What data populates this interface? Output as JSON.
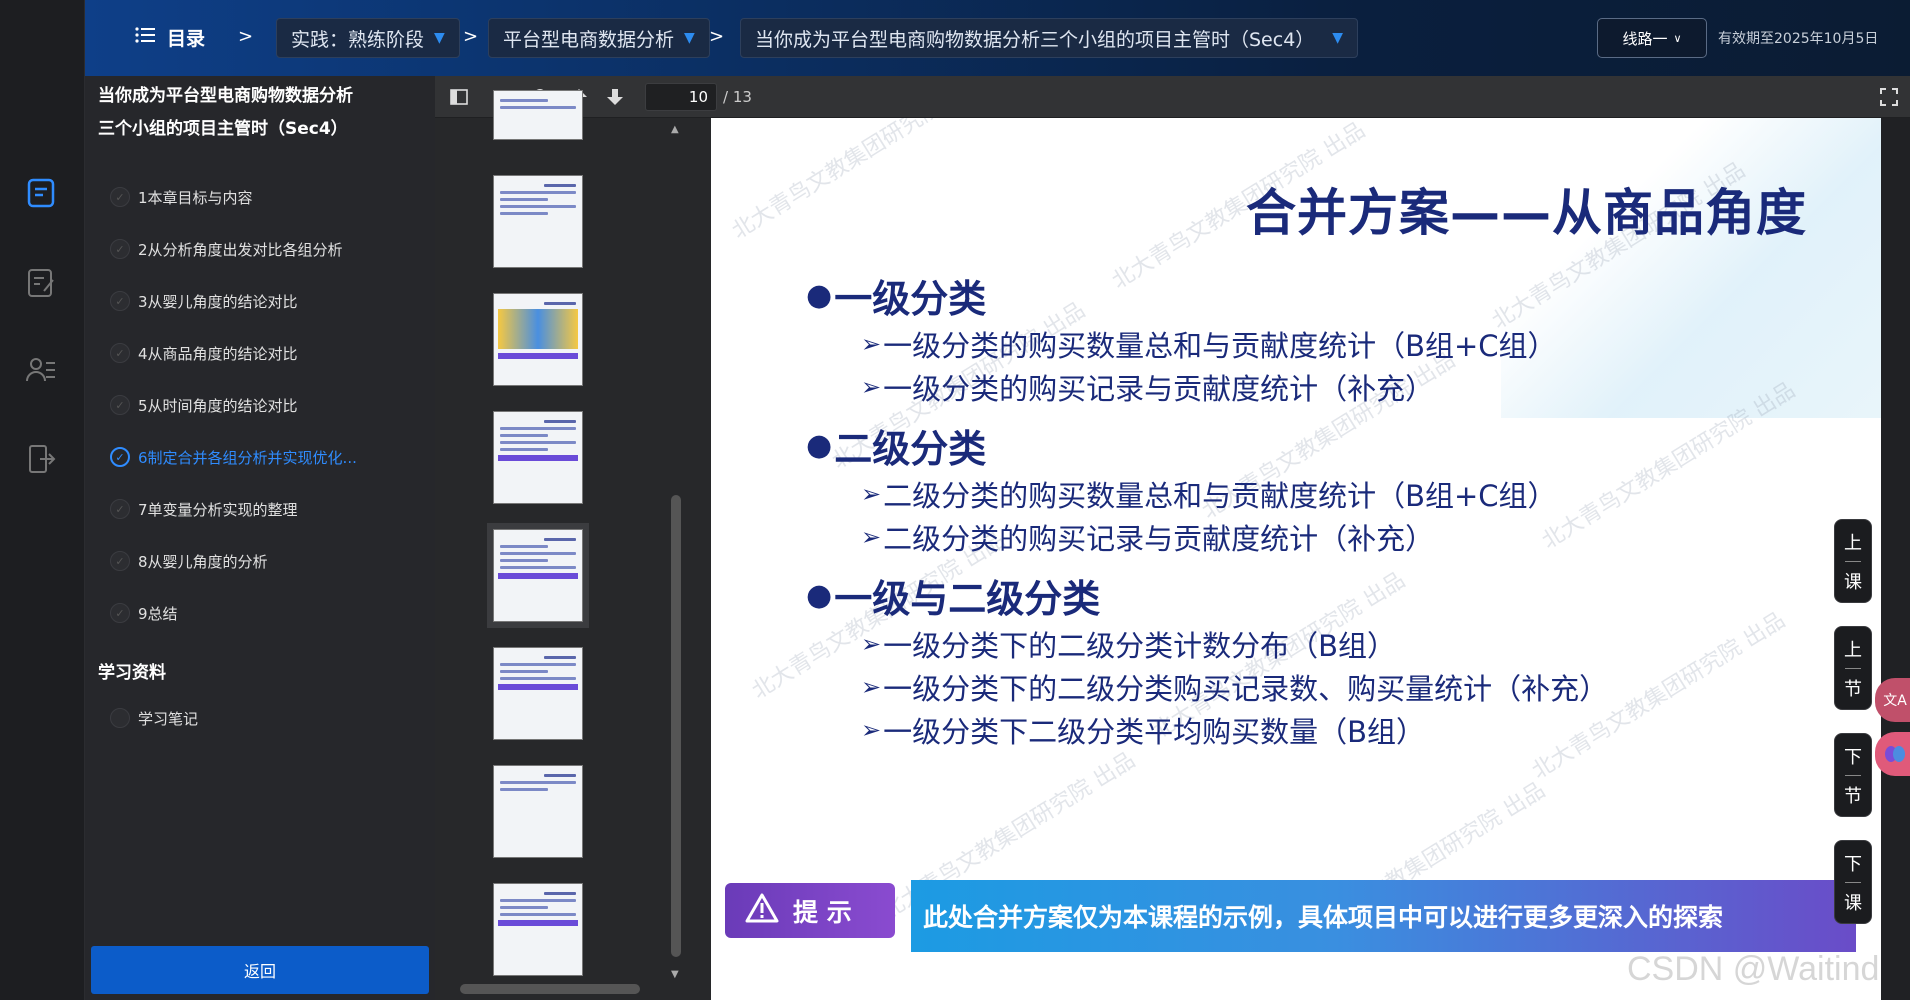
{
  "header": {
    "toc_label": "目录",
    "breadcrumbs": [
      "实践：熟练阶段",
      "平台型电商数据分析",
      "当你成为平台型电商购物数据分析三个小组的项目主管时（Sec4）"
    ],
    "line_button": "线路一",
    "expiry": "有效期至2025年10月5日"
  },
  "sidebar": {
    "course_title": "当你成为平台型电商购物数据分析三个小组的项目主管时（Sec4）",
    "lessons": [
      {
        "label": "1本章目标与内容",
        "active": false
      },
      {
        "label": "2从分析角度出发对比各组分析",
        "active": false
      },
      {
        "label": "3从婴儿角度的结论对比",
        "active": false
      },
      {
        "label": "4从商品角度的结论对比",
        "active": false
      },
      {
        "label": "5从时间角度的结论对比",
        "active": false
      },
      {
        "label": "6制定合并各组分析并实现优化...",
        "active": true
      },
      {
        "label": "7单变量分析实现的整理",
        "active": false
      },
      {
        "label": "8从婴儿角度的分析",
        "active": false
      },
      {
        "label": "9总结",
        "active": false
      }
    ],
    "materials_heading": "学习资料",
    "materials": [
      {
        "label": "学习笔记"
      }
    ],
    "back_button": "返回"
  },
  "viewer": {
    "current_page": "10",
    "total_pages": "/ 13"
  },
  "slide": {
    "title": "合并方案——从商品角度",
    "sections": [
      {
        "heading": "一级分类",
        "items": [
          "一级分类的购买数量总和与贡献度统计（B组+C组）",
          "一级分类的购买记录与贡献度统计（补充）"
        ]
      },
      {
        "heading": "二级分类",
        "items": [
          "二级分类的购买数量总和与贡献度统计（B组+C组）",
          "二级分类的购买记录与贡献度统计（补充）"
        ]
      },
      {
        "heading": "一级与二级分类",
        "items": [
          "一级分类下的二级分类计数分布（B组）",
          "一级分类下的二级分类购买记录数、购买量统计（补充）",
          "一级分类下二级分类平均购买数量（B组）"
        ]
      }
    ],
    "tip_label": "提 示",
    "tip_text": "此处合并方案仅为本课程的示例，具体项目中可以进行更多更深入的探索",
    "watermark": "北大青鸟文教集团研究院 出品"
  },
  "side_nav": {
    "prev_lesson": [
      "上",
      "课"
    ],
    "prev_section": [
      "上",
      "节"
    ],
    "next_section": [
      "下",
      "节"
    ],
    "next_lesson": [
      "下",
      "课"
    ]
  },
  "floating": {
    "translate": "文A"
  },
  "footer_watermark": "CSDN @Waitind"
}
